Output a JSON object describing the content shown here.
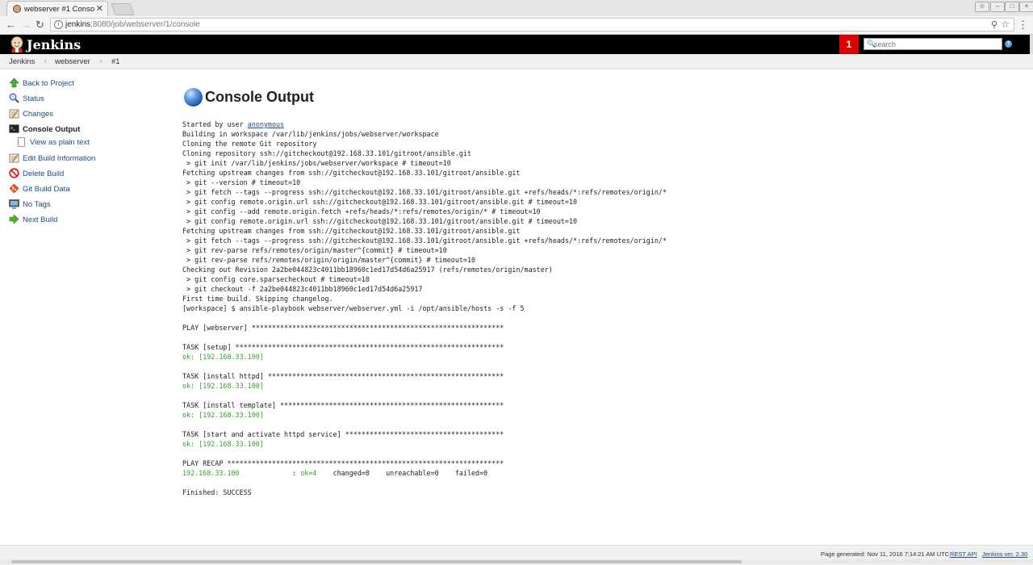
{
  "browser": {
    "tab_title": "webserver #1 Conso",
    "tab_close": "✕",
    "url_host": "jenkins",
    "url_rest": ":8080/job/webserver/1/console"
  },
  "header": {
    "brand": "Jenkins",
    "notification_count": "1",
    "search_placeholder": "search",
    "help": "?"
  },
  "breadcrumb": [
    "Jenkins",
    "webserver",
    "#1"
  ],
  "sidebar": {
    "items": [
      {
        "label": "Back to Project",
        "icon": "up-arrow-icon"
      },
      {
        "label": "Status",
        "icon": "magnifier-icon"
      },
      {
        "label": "Changes",
        "icon": "notepad-icon"
      },
      {
        "label": "Console Output",
        "icon": "terminal-icon"
      },
      {
        "label": "Edit Build Information",
        "icon": "notepad-edit-icon"
      },
      {
        "label": "Delete Build",
        "icon": "no-entry-icon"
      },
      {
        "label": "Git Build Data",
        "icon": "git-icon"
      },
      {
        "label": "No Tags",
        "icon": "monitor-icon"
      },
      {
        "label": "Next Build",
        "icon": "right-arrow-icon"
      }
    ],
    "sub_item": "View as plain text"
  },
  "main": {
    "title": "Console Output",
    "started_prefix": "Started by user ",
    "started_user": "anonymous",
    "lines": [
      "Building in workspace /var/lib/jenkins/jobs/webserver/workspace",
      "Cloning the remote Git repository",
      "Cloning repository ssh://gitcheckout@192.168.33.101/gitroot/ansible.git",
      " > git init /var/lib/jenkins/jobs/webserver/workspace # timeout=10",
      "Fetching upstream changes from ssh://gitcheckout@192.168.33.101/gitroot/ansible.git",
      " > git --version # timeout=10",
      " > git fetch --tags --progress ssh://gitcheckout@192.168.33.101/gitroot/ansible.git +refs/heads/*:refs/remotes/origin/*",
      " > git config remote.origin.url ssh://gitcheckout@192.168.33.101/gitroot/ansible.git # timeout=10",
      " > git config --add remote.origin.fetch +refs/heads/*:refs/remotes/origin/* # timeout=10",
      " > git config remote.origin.url ssh://gitcheckout@192.168.33.101/gitroot/ansible.git # timeout=10",
      "Fetching upstream changes from ssh://gitcheckout@192.168.33.101/gitroot/ansible.git",
      " > git fetch --tags --progress ssh://gitcheckout@192.168.33.101/gitroot/ansible.git +refs/heads/*:refs/remotes/origin/*",
      " > git rev-parse refs/remotes/origin/master^{commit} # timeout=10",
      " > git rev-parse refs/remotes/origin/origin/master^{commit} # timeout=10",
      "Checking out Revision 2a2be044823c4011bb18960c1ed17d54d6a25917 (refs/remotes/origin/master)",
      " > git config core.sparsecheckout # timeout=10",
      " > git checkout -f 2a2be044823c4011bb18960c1ed17d54d6a25917",
      "First time build. Skipping changelog.",
      "[workspace] $ ansible-playbook webserver/webserver.yml -i /opt/ansible/hosts -s -f 5",
      "",
      "PLAY [webserver] **************************************************************",
      "",
      "TASK [setup] ******************************************************************",
      "ok: [192.168.33.100]",
      "",
      "TASK [install httpd] **********************************************************",
      "ok: [192.168.33.100]",
      "",
      "TASK [install template] *******************************************************",
      "ok: [192.168.33.100]",
      "",
      "TASK [start and activate httpd service] ***************************************",
      "ok: [192.168.33.100]",
      "",
      "PLAY RECAP ********************************************************************"
    ],
    "recap": {
      "host": "192.168.33.100",
      "pad": "             : ",
      "ok": "ok=4",
      "rest": "    changed=0    unreachable=0    failed=0"
    },
    "finished": "Finished: SUCCESS"
  },
  "footer": {
    "generated": "Page generated: Nov 11, 2016 7:14:21 AM UTC",
    "rest_api": "REST API",
    "version": "Jenkins ver. 2.30"
  },
  "colors": {
    "header_bg": "#000000",
    "notification_bg": "#dd0000",
    "link": "#204a87",
    "ok_green": "#3a9e2e"
  }
}
